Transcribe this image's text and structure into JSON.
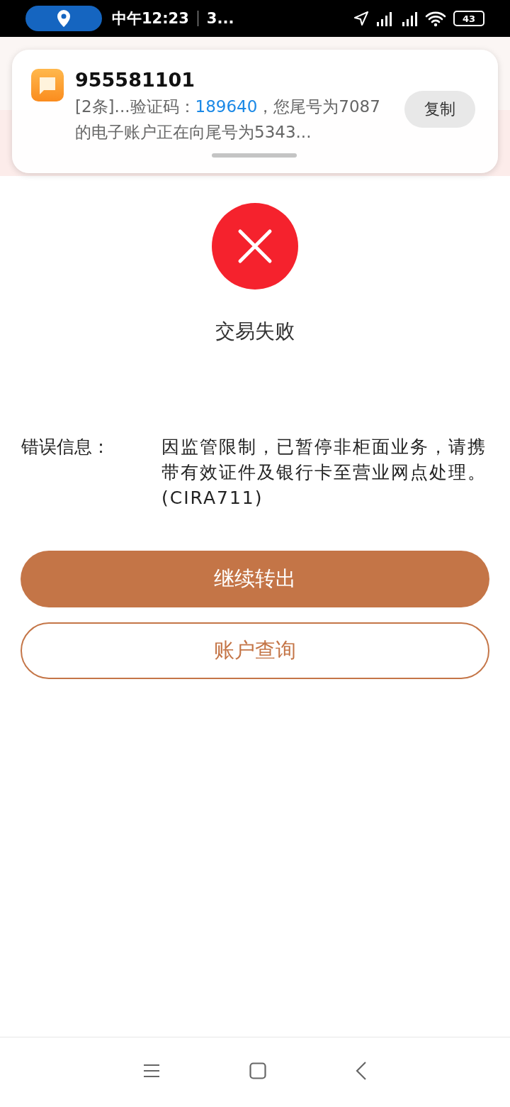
{
  "status_bar": {
    "time": "中午12:23",
    "extra": "3...",
    "battery": "43"
  },
  "notification": {
    "sender": "955581101",
    "message_prefix": "[2条]...验证码：",
    "code": "189640",
    "message_rest": "，您尾号为7087的电子账户正在向尾号为5343...",
    "copy_button": "复制"
  },
  "result": {
    "title": "交易失败"
  },
  "error": {
    "label": "错误信息：",
    "message": "因监管限制，已暂停非柜面业务，请携带有效证件及银行卡至营业网点处理。(CIRA711)"
  },
  "buttons": [
    {
      "label": "继续转出",
      "kind": "primary"
    },
    {
      "label": "账户查询",
      "kind": "outline"
    }
  ]
}
